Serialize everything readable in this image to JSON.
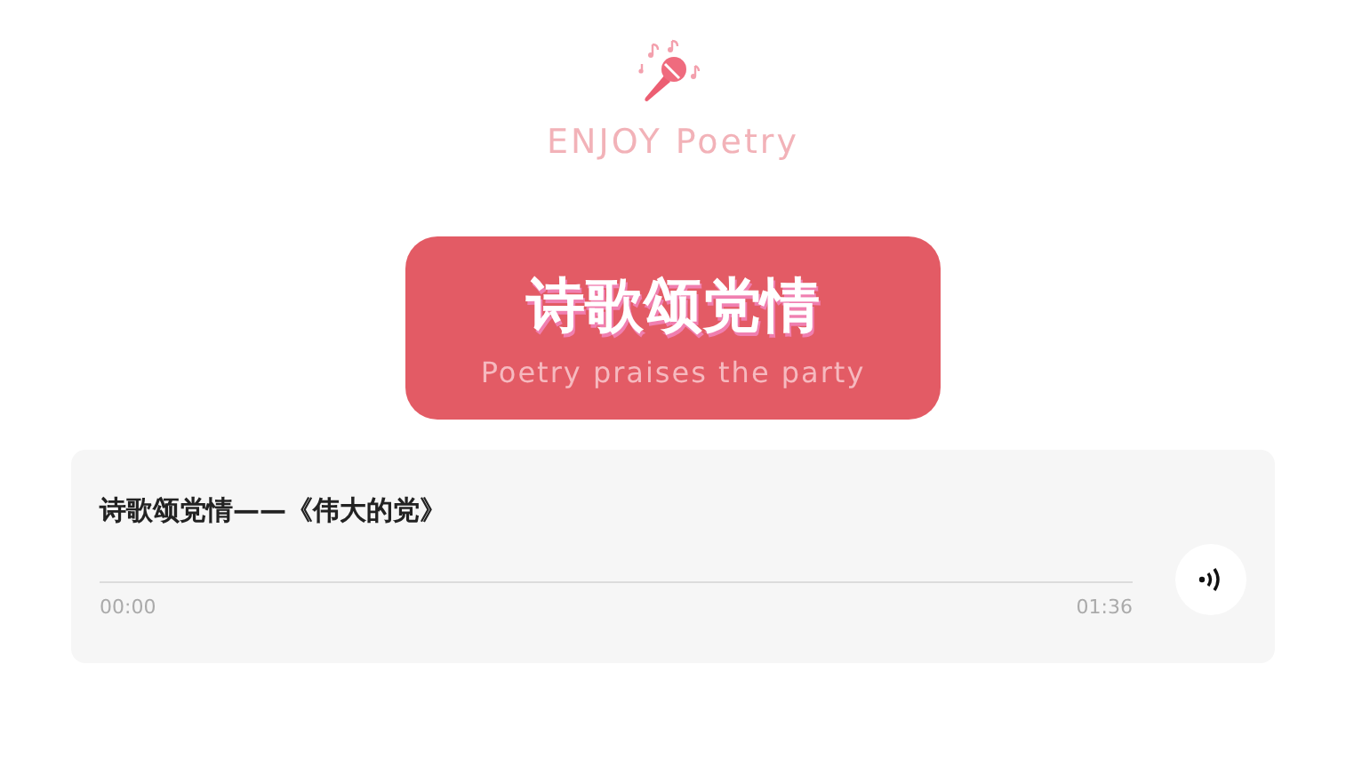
{
  "header": {
    "brand": "ENJOY Poetry"
  },
  "banner": {
    "title": "诗歌颂党情",
    "subtitle": "Poetry praises the party"
  },
  "player": {
    "track_title": "诗歌颂党情——《伟大的党》",
    "level": 0,
    "elapsed": "00:00",
    "duration": "01:36"
  }
}
